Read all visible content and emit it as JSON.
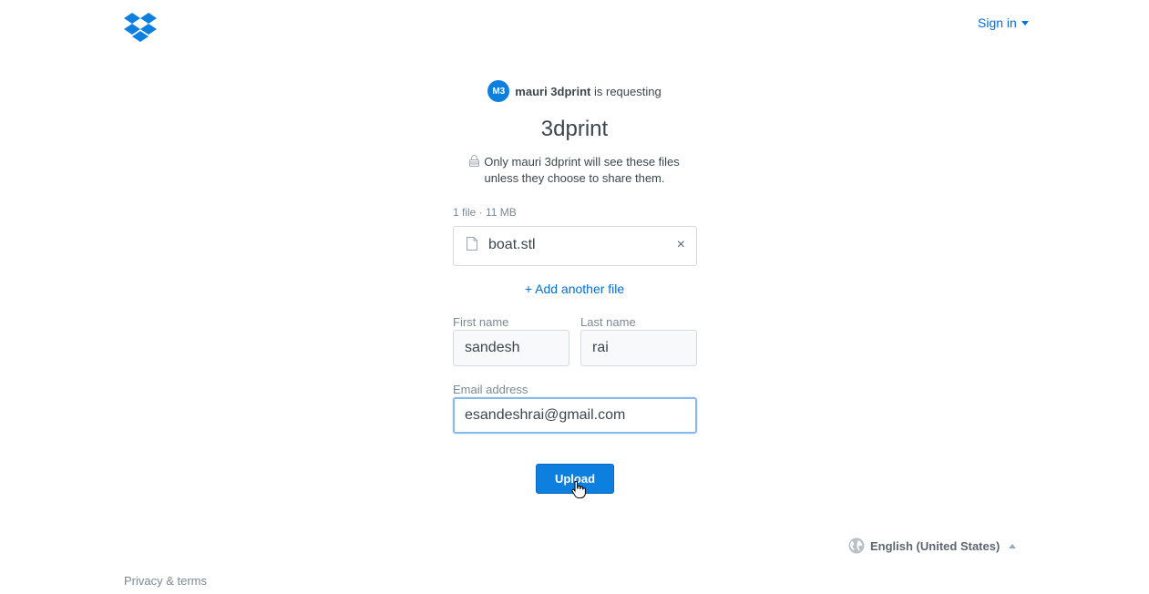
{
  "header": {
    "logo_icon": "dropbox-logo-icon",
    "sign_in_label": "Sign in",
    "brand_color": "#0070e0"
  },
  "request": {
    "avatar_initials": "M3",
    "requester_name": "mauri 3dprint",
    "requesting_text": "is requesting",
    "title": "3dprint",
    "privacy_line1": "Only mauri 3dprint will see these files",
    "privacy_line2": "unless they choose to share them."
  },
  "files": {
    "summary": "1 file · 11 MB",
    "items": [
      {
        "name": "boat.stl",
        "icon": "file-icon",
        "remove_glyph": "×"
      }
    ],
    "add_label": "+ Add another file"
  },
  "form": {
    "first_name_label": "First name",
    "first_name_value": "sandesh",
    "last_name_label": "Last name",
    "last_name_value": "rai",
    "email_label": "Email address",
    "email_value": "esandeshrai@gmail.com",
    "submit_label": "Upload"
  },
  "footer": {
    "language_label": "English (United States)",
    "language_icon": "globe-icon",
    "privacy_terms_label": "Privacy & terms"
  }
}
